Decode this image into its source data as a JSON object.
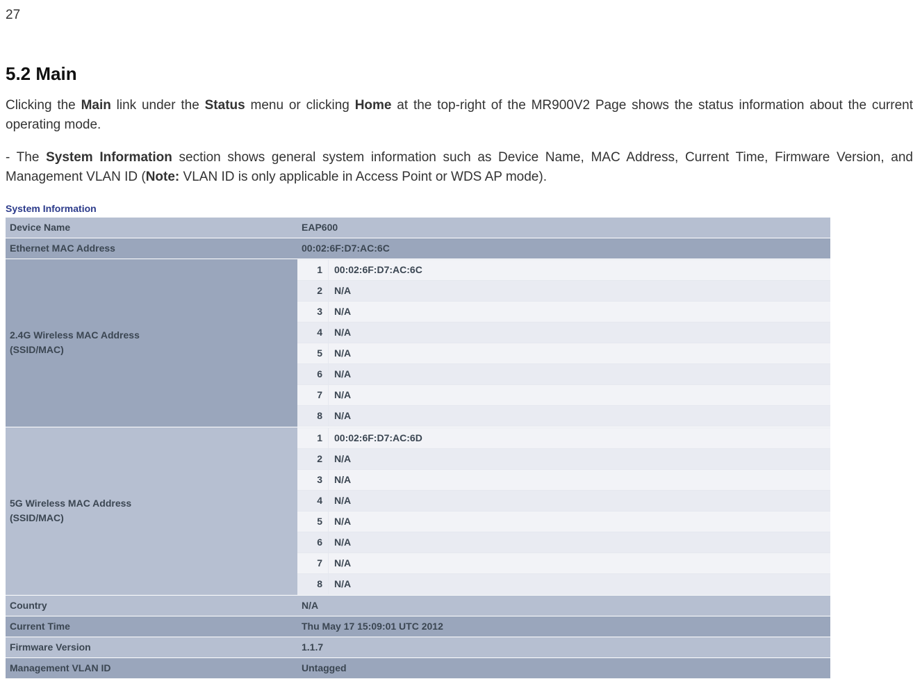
{
  "page_number": "27",
  "heading": "5.2   Main",
  "para1_parts": {
    "p1": "Clicking the ",
    "b1": "Main",
    "p2": " link under the ",
    "b2": "Status",
    "p3": " menu or clicking ",
    "b3": "Home",
    "p4": " at the top-right of the MR900V2 Page shows the status information about the current operating mode."
  },
  "para2_parts": {
    "p1": "- The ",
    "b1": "System Information",
    "p2": " section shows general system information such as Device Name, MAC Address, Current Time, Firmware Version, and Management VLAN ID (",
    "b2": "Note:",
    "p3": " VLAN ID is only applicable in Access Point or WDS AP mode)."
  },
  "sysinfo_title": "System Information",
  "labels": {
    "device_name": "Device Name",
    "eth_mac": "Ethernet MAC Address",
    "wmac24": "2.4G Wireless MAC Address",
    "wmac24_sub": "(SSID/MAC)",
    "wmac5": "5G Wireless MAC Address",
    "wmac5_sub": "(SSID/MAC)",
    "country": "Country",
    "current_time": "Current Time",
    "fw": "Firmware Version",
    "vlan": "Management VLAN ID"
  },
  "values": {
    "device_name": "EAP600",
    "eth_mac": "00:02:6F:D7:AC:6C",
    "country": "N/A",
    "current_time": "Thu May 17 15:09:01 UTC 2012",
    "fw": "1.1.7",
    "vlan": "Untagged"
  },
  "wmac24_list": [
    {
      "idx": "1",
      "val": "00:02:6F:D7:AC:6C"
    },
    {
      "idx": "2",
      "val": "N/A"
    },
    {
      "idx": "3",
      "val": "N/A"
    },
    {
      "idx": "4",
      "val": "N/A"
    },
    {
      "idx": "5",
      "val": "N/A"
    },
    {
      "idx": "6",
      "val": "N/A"
    },
    {
      "idx": "7",
      "val": "N/A"
    },
    {
      "idx": "8",
      "val": "N/A"
    }
  ],
  "wmac5_list": [
    {
      "idx": "1",
      "val": "00:02:6F:D7:AC:6D"
    },
    {
      "idx": "2",
      "val": "N/A"
    },
    {
      "idx": "3",
      "val": "N/A"
    },
    {
      "idx": "4",
      "val": "N/A"
    },
    {
      "idx": "5",
      "val": "N/A"
    },
    {
      "idx": "6",
      "val": "N/A"
    },
    {
      "idx": "7",
      "val": "N/A"
    },
    {
      "idx": "8",
      "val": "N/A"
    }
  ]
}
